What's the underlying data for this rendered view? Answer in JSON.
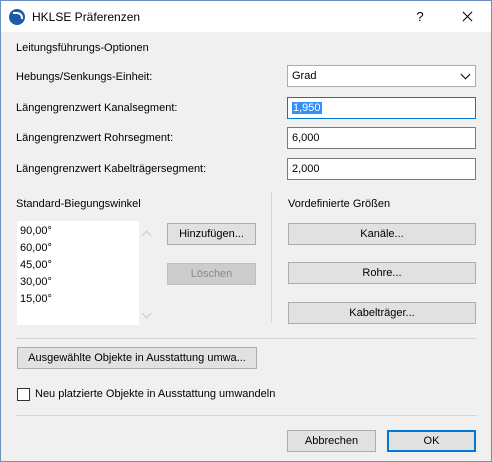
{
  "window": {
    "title": "HKLSE Präferenzen",
    "help_label": "?"
  },
  "section_title": "Leitungsführungs-Optionen",
  "fields": {
    "unit_label": "Hebungs/Senkungs-Einheit:",
    "unit_value": "Grad",
    "duct_label": "Längengrenzwert Kanalsegment:",
    "duct_value": "1,950",
    "pipe_label": "Längengrenzwert Rohrsegment:",
    "pipe_value": "6,000",
    "tray_label": "Längengrenzwert Kabelträgersegment:",
    "tray_value": "2,000"
  },
  "bend_angles": {
    "title": "Standard-Biegungswinkel",
    "items": [
      "90,00°",
      "60,00°",
      "45,00°",
      "30,00°",
      "15,00°"
    ],
    "add_label": "Hinzufügen...",
    "delete_label": "Löschen"
  },
  "predefined": {
    "title": "Vordefinierte Größen",
    "ducts_label": "Kanäle...",
    "pipes_label": "Rohre...",
    "trays_label": "Kabelträger..."
  },
  "convert_button_label": "Ausgewählte Objekte in Ausstattung umwa...",
  "auto_convert": {
    "label": "Neu platzierte Objekte in Ausstattung umwandeln",
    "checked": false
  },
  "footer": {
    "cancel_label": "Abbrechen",
    "ok_label": "OK"
  },
  "colors": {
    "focus_border": "#0078d7",
    "selection": "#3390ff",
    "title_icon": "#1d5aa8"
  }
}
